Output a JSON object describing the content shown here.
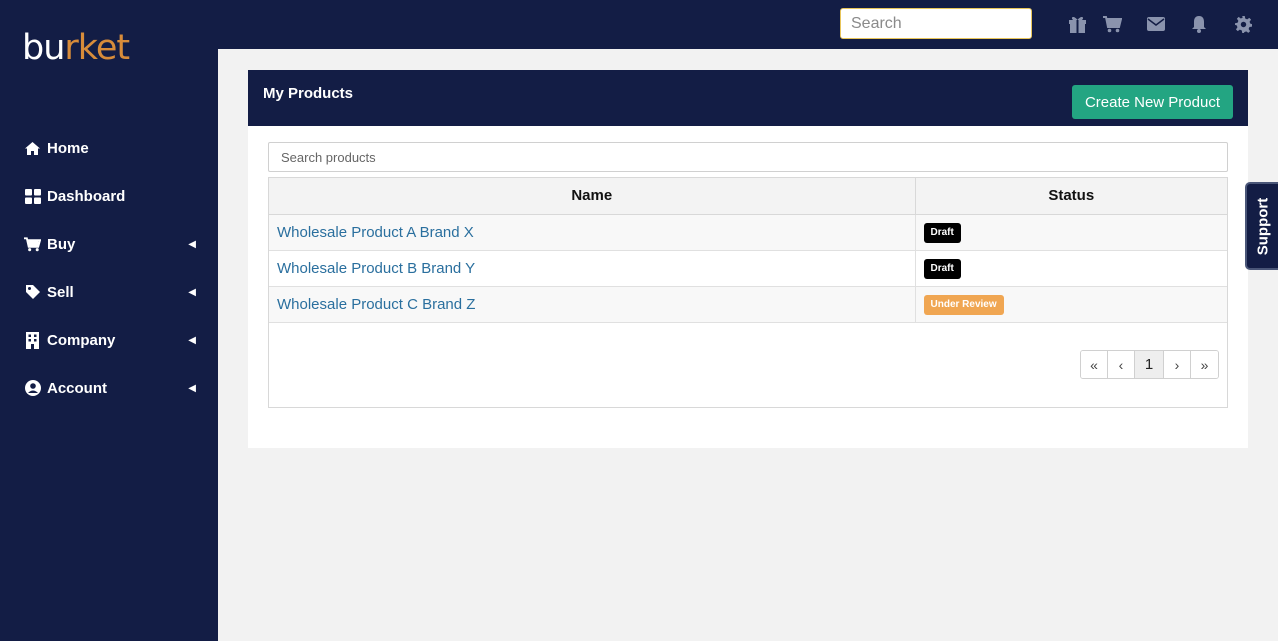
{
  "brand": {
    "logo_part1": "bu",
    "logo_part2": "rket",
    "accent": "#d88c3a"
  },
  "colors": {
    "navy": "#131d45",
    "green": "#23a582",
    "link": "#2a6f9e"
  },
  "topbar": {
    "search_placeholder": "Search",
    "icons": [
      "gift-icon",
      "cart-icon",
      "envelope-icon",
      "bell-icon",
      "gear-icon"
    ]
  },
  "sidebar": {
    "items": [
      {
        "label": "Home",
        "icon": "home-icon",
        "expandable": false
      },
      {
        "label": "Dashboard",
        "icon": "dashboard-icon",
        "expandable": false
      },
      {
        "label": "Buy",
        "icon": "cart-icon",
        "expandable": true
      },
      {
        "label": "Sell",
        "icon": "tag-icon",
        "expandable": true
      },
      {
        "label": "Company",
        "icon": "building-icon",
        "expandable": true
      },
      {
        "label": "Account",
        "icon": "user-circle-icon",
        "expandable": true
      }
    ]
  },
  "panel": {
    "title": "My Products",
    "create_button": "Create New Product",
    "search_placeholder": "Search products",
    "columns": [
      "Name",
      "Status"
    ],
    "rows": [
      {
        "name": "Wholesale Product A Brand X",
        "status": "Draft",
        "status_color": "#000000"
      },
      {
        "name": "Wholesale Product B Brand Y",
        "status": "Draft",
        "status_color": "#000000"
      },
      {
        "name": "Wholesale Product C Brand Z",
        "status": "Under Review",
        "status_color": "#f0a652"
      }
    ],
    "pagination": {
      "first": "«",
      "prev": "‹",
      "current": "1",
      "next": "›",
      "last": "»"
    }
  },
  "support": {
    "label": "Support"
  }
}
